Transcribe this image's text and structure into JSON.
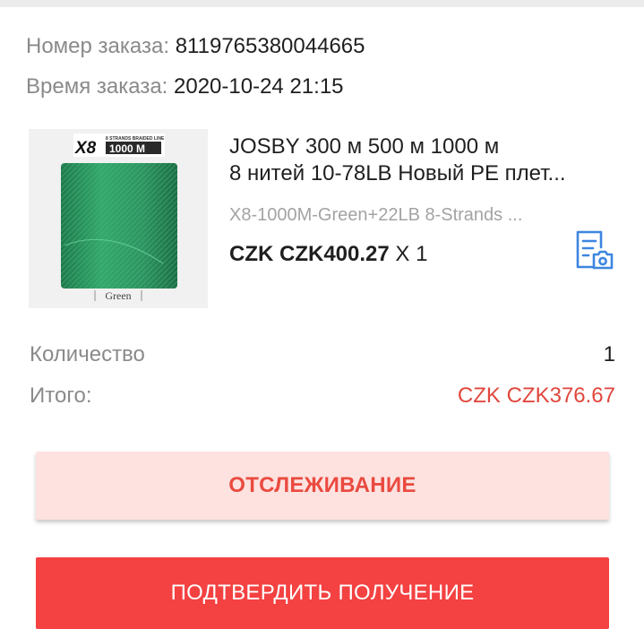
{
  "order": {
    "number_label": "Номер заказа:",
    "number_value": "8119765380044665",
    "time_label": "Время заказа:",
    "time_value": "2020-10-24 21:15"
  },
  "product": {
    "image_brand": "X8",
    "image_subtitle": "8 STRANDS BRAIDED LINE",
    "image_length": "1000 M",
    "image_color_label": "Green",
    "title_line1": "JOSBY 300 м 500 м 1000 м",
    "title_line2": "8 нитей 10-78LB Новый PE плет...",
    "sku": "X8-1000M-Green+22LB  8-Strands ...",
    "price": "CZK CZK400.27",
    "quantity_text": "X 1"
  },
  "summary": {
    "quantity_label": "Количество",
    "quantity_value": "1",
    "total_label": "Итого:",
    "total_value": "CZK CZK376.67"
  },
  "buttons": {
    "tracking": "ОТСЛЕЖИВАНИЕ",
    "confirm": "ПОДТВЕРДИТЬ ПОЛУЧЕНИЕ"
  },
  "colors": {
    "accent_red": "#f44141",
    "total_red": "#e0473d",
    "icon_blue": "#3d86e0",
    "spool_green": "#2e9461"
  },
  "icons": {
    "receipt": "receipt-camera-icon"
  }
}
